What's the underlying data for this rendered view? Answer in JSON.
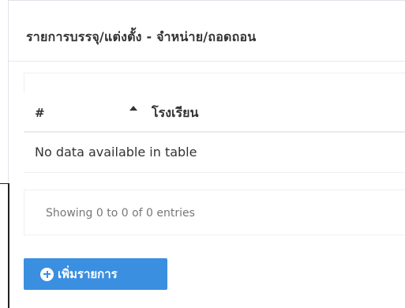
{
  "panel": {
    "title": "รายการบรรจุ/แต่งตั้ง - จำหน่าย/ถอดถอน"
  },
  "table": {
    "columns": [
      "#",
      "โรงเรียน"
    ],
    "sort_icon": "sort-asc-icon",
    "empty_message": "No data available in table",
    "info": "Showing 0 to 0 of 0 entries"
  },
  "add_button": {
    "label": "เพิ่มรายการ",
    "icon": "plus-circle-icon",
    "color": "#3a8fe0"
  }
}
